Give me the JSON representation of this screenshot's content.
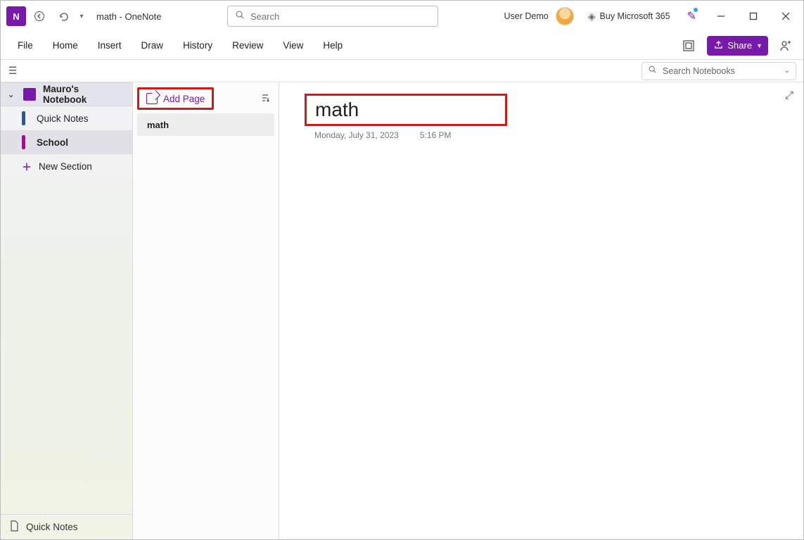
{
  "titlebar": {
    "app_abbr": "N",
    "title": "math  -  OneNote",
    "search_placeholder": "Search"
  },
  "user": {
    "name": "User Demo"
  },
  "buy": {
    "label": "Buy Microsoft 365"
  },
  "ribbon": {
    "tabs": [
      "File",
      "Home",
      "Insert",
      "Draw",
      "History",
      "Review",
      "View",
      "Help"
    ],
    "share": "Share"
  },
  "subbar": {
    "search_notebooks": "Search Notebooks"
  },
  "sidebar": {
    "notebook": "Mauro's Notebook",
    "sections": [
      {
        "label": "Quick Notes",
        "color": "blue",
        "active": false
      },
      {
        "label": "School",
        "color": "magenta",
        "active": true
      }
    ],
    "new_section": "New Section",
    "footer": "Quick Notes"
  },
  "pagelist": {
    "add_page": "Add Page",
    "pages": [
      {
        "label": "math"
      }
    ]
  },
  "editor": {
    "title": "math",
    "date": "Monday, July 31, 2023",
    "time": "5:16 PM"
  }
}
